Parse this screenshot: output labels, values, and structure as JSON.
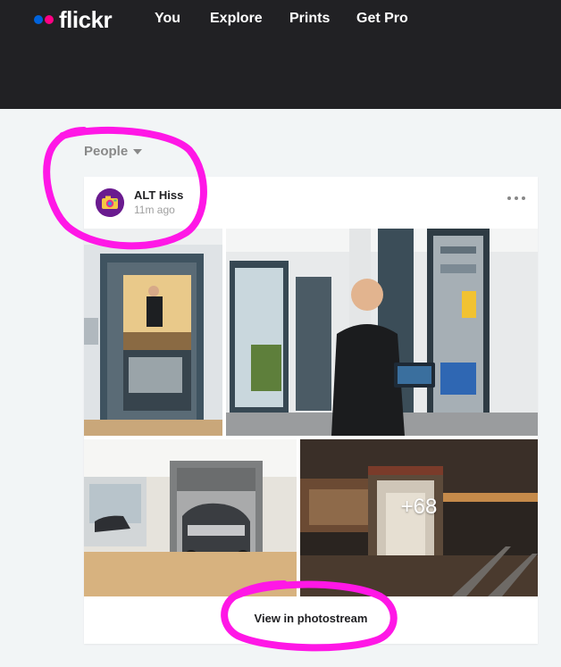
{
  "brand": {
    "name": "flickr",
    "colors": {
      "blue": "#0063dc",
      "pink": "#ff0084"
    }
  },
  "nav": {
    "items": [
      "You",
      "Explore",
      "Prints",
      "Get Pro"
    ]
  },
  "filter": {
    "label": "People"
  },
  "card": {
    "user": {
      "name": "ALT Hiss",
      "time": "11m ago"
    },
    "more_photos_count": "+68",
    "view_link": "View in photostream"
  },
  "annotation": {
    "color": "#ff17e6"
  }
}
